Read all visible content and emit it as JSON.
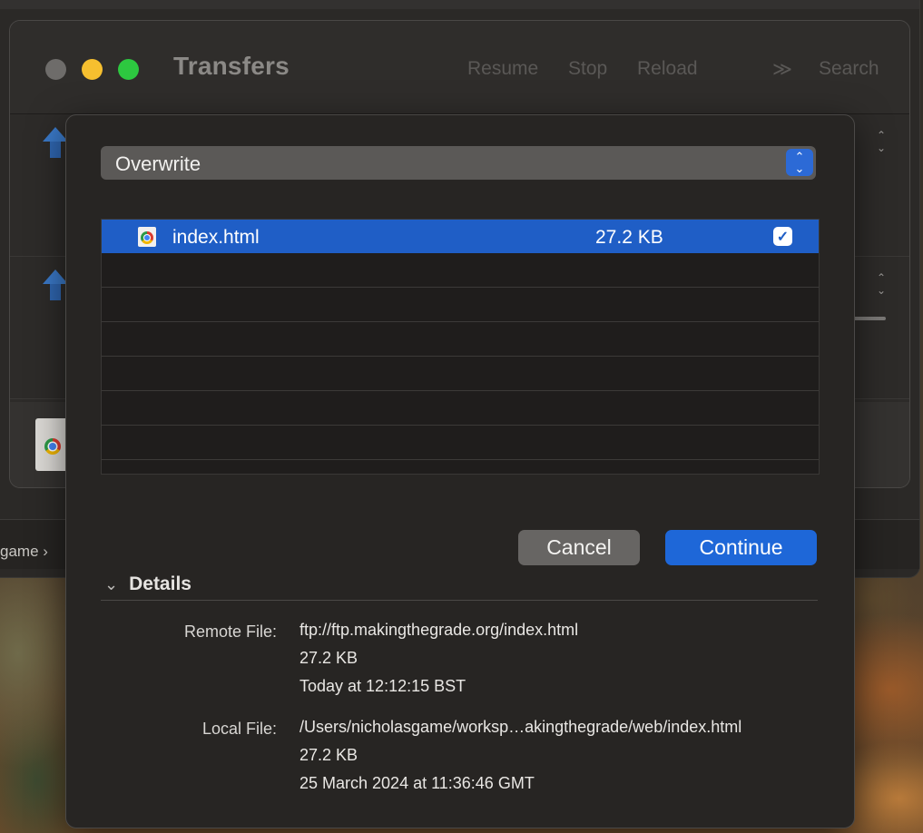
{
  "background": {
    "breadcrumb_fragment": "game ›"
  },
  "transfers_window": {
    "title": "Transfers",
    "toolbar": {
      "resume_label": "Resume",
      "stop_label": "Stop",
      "reload_label": "Reload",
      "overflow_label": "≫",
      "search_label": "Search"
    }
  },
  "dialog": {
    "action_select": {
      "selected": "Overwrite"
    },
    "files": {
      "rows": [
        {
          "name": "index.html",
          "size": "27.2 KB",
          "checked": true
        }
      ]
    },
    "buttons": {
      "cancel_label": "Cancel",
      "continue_label": "Continue"
    },
    "details": {
      "heading": "Details",
      "remote": {
        "label": "Remote File:",
        "path": "ftp://ftp.makingthegrade.org/index.html",
        "size": "27.2 KB",
        "date": "Today at 12:12:15 BST"
      },
      "local": {
        "label": "Local File:",
        "path": "/Users/nicholasgame/worksp…akingthegrade/web/index.html",
        "size": "27.2 KB",
        "date": "25 March 2024 at 11:36:46 GMT"
      }
    }
  },
  "colors": {
    "accent": "#1e67d8",
    "selection": "#1f5ec6",
    "traffic_close_inactive": "#6e6c6a",
    "traffic_minimize": "#f6bf2f",
    "traffic_zoom": "#2dc840"
  }
}
